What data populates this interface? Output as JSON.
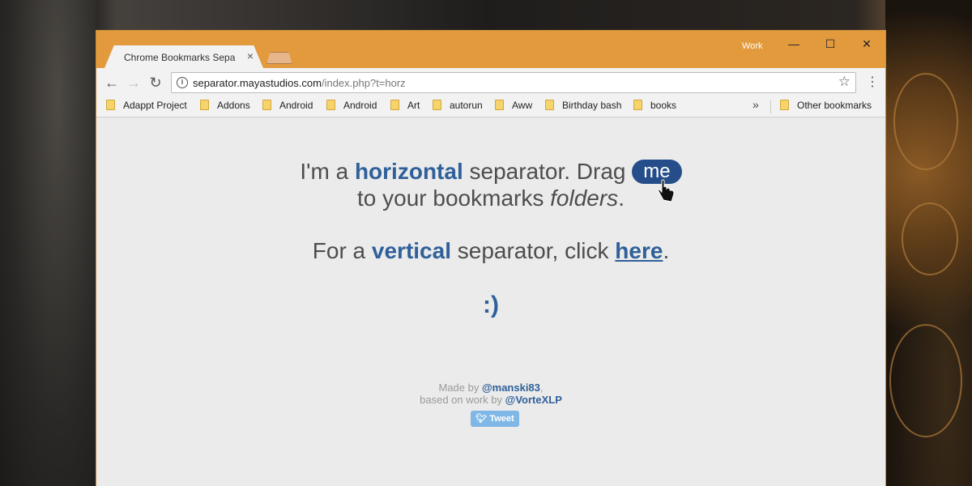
{
  "window": {
    "tab_title": "Chrome Bookmarks Sepa",
    "profile": "Work",
    "controls": {
      "minimize": "—",
      "maximize": "☐",
      "close": "✕"
    }
  },
  "toolbar": {
    "url_host": "separator.mayastudios.com",
    "url_path": "/index.php?t=horz"
  },
  "bookmarks": {
    "items": [
      "Adappt Project",
      "Addons",
      "Android",
      "Android",
      "Art",
      "autorun",
      "Aww",
      "Birthday bash",
      "books"
    ],
    "other": "Other bookmarks"
  },
  "content": {
    "l1_a": "I'm a ",
    "l1_b": "horizontal",
    "l1_c": " separator. Drag ",
    "l1_pill": "me",
    "l2_a": "to your bookmarks ",
    "l2_b": "folders",
    "l2_c": ".",
    "l3_a": "For a ",
    "l3_b": "vertical",
    "l3_c": " separator, click ",
    "l3_link": "here",
    "l3_d": ".",
    "smiley": ":)",
    "credit1_a": "Made by ",
    "credit1_b": "@manski83",
    "credit1_c": ",",
    "credit2_a": "based on work by ",
    "credit2_b": "@VorteXLP",
    "tweet_label": "Tweet"
  },
  "colors": {
    "titlebar": "#e29a3d",
    "accent": "#2f6099",
    "pill": "#254d8a",
    "tweet": "#7fb8e6"
  }
}
